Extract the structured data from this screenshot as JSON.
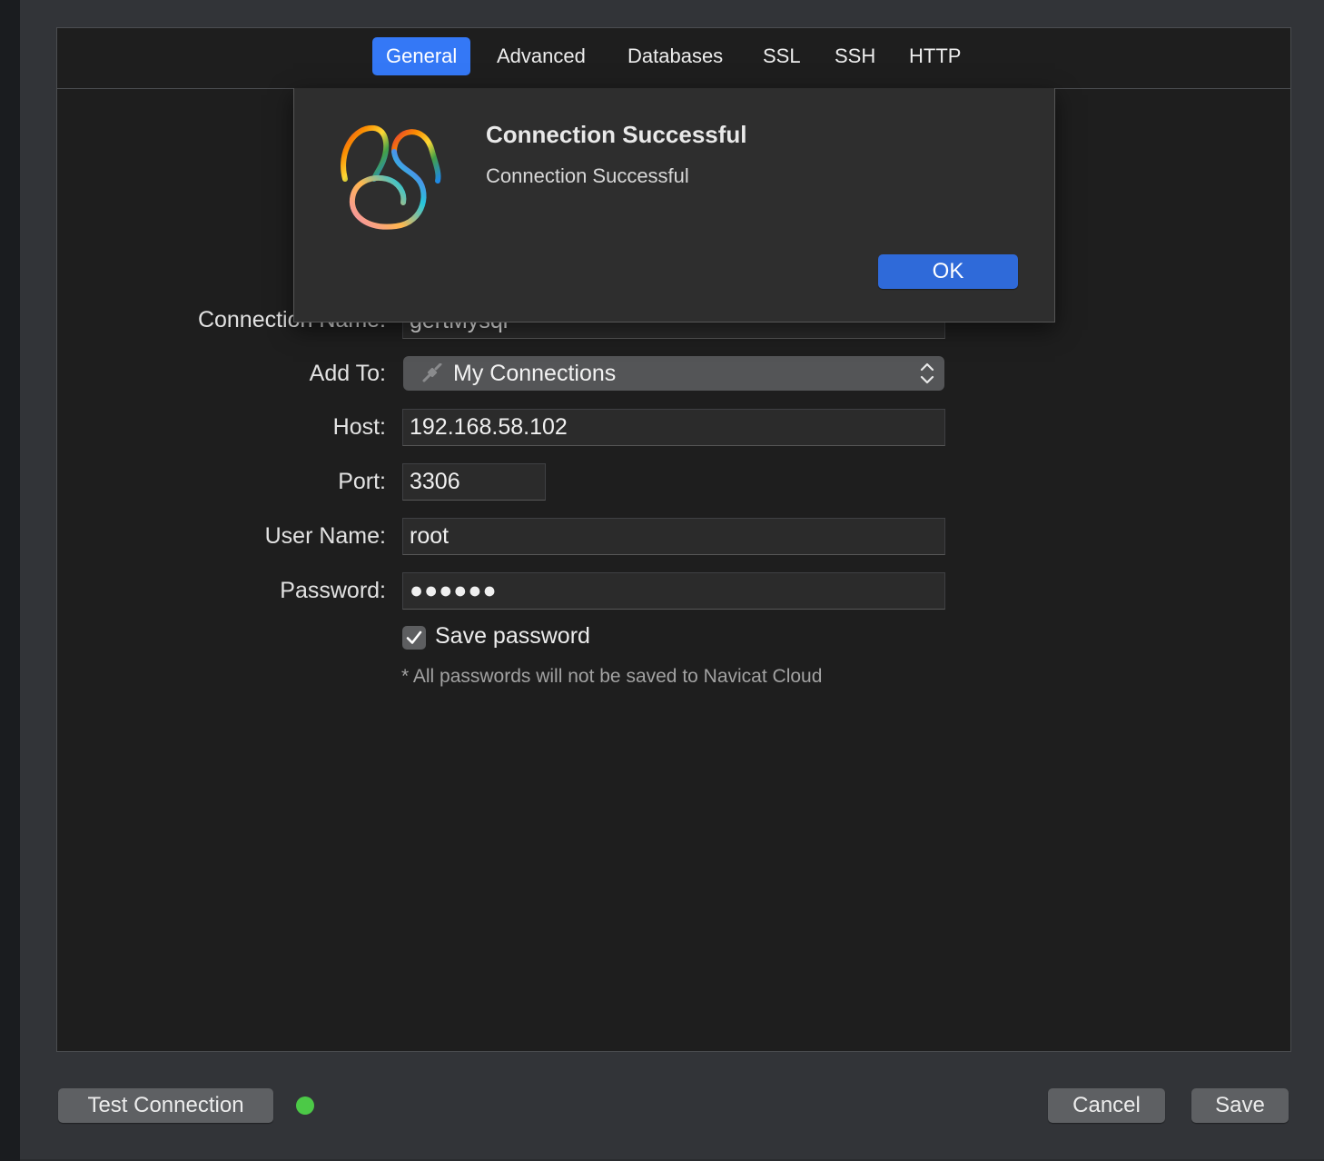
{
  "tabs": [
    {
      "label": "General",
      "active": true
    },
    {
      "label": "Advanced"
    },
    {
      "label": "Databases"
    },
    {
      "label": "SSL"
    },
    {
      "label": "SSH"
    },
    {
      "label": "HTTP"
    }
  ],
  "form": {
    "connection_name": {
      "label": "Connection Name:",
      "value": "gertMysql"
    },
    "add_to": {
      "label": "Add To:",
      "value": "My Connections",
      "icon": "connection-plug-icon"
    },
    "host": {
      "label": "Host:",
      "value": "192.168.58.102"
    },
    "port": {
      "label": "Port:",
      "value": "3306"
    },
    "user_name": {
      "label": "User Name:",
      "value": "root"
    },
    "password": {
      "label": "Password:",
      "value": "●●●●●●"
    },
    "save_password": {
      "label": "Save password",
      "checked": true
    },
    "note": "* All passwords will not be saved to Navicat Cloud"
  },
  "footer": {
    "test_connection_label": "Test Connection",
    "status_color": "#4cc947",
    "cancel_label": "Cancel",
    "save_label": "Save"
  },
  "dialog": {
    "title": "Connection Successful",
    "message": "Connection Successful",
    "ok_label": "OK",
    "icon": "navicat-logo-icon"
  },
  "colors": {
    "accent": "#3478f6",
    "ok_button": "#2f6ad9",
    "panel_bg": "#1e1e1e",
    "window_bg": "#323438"
  }
}
